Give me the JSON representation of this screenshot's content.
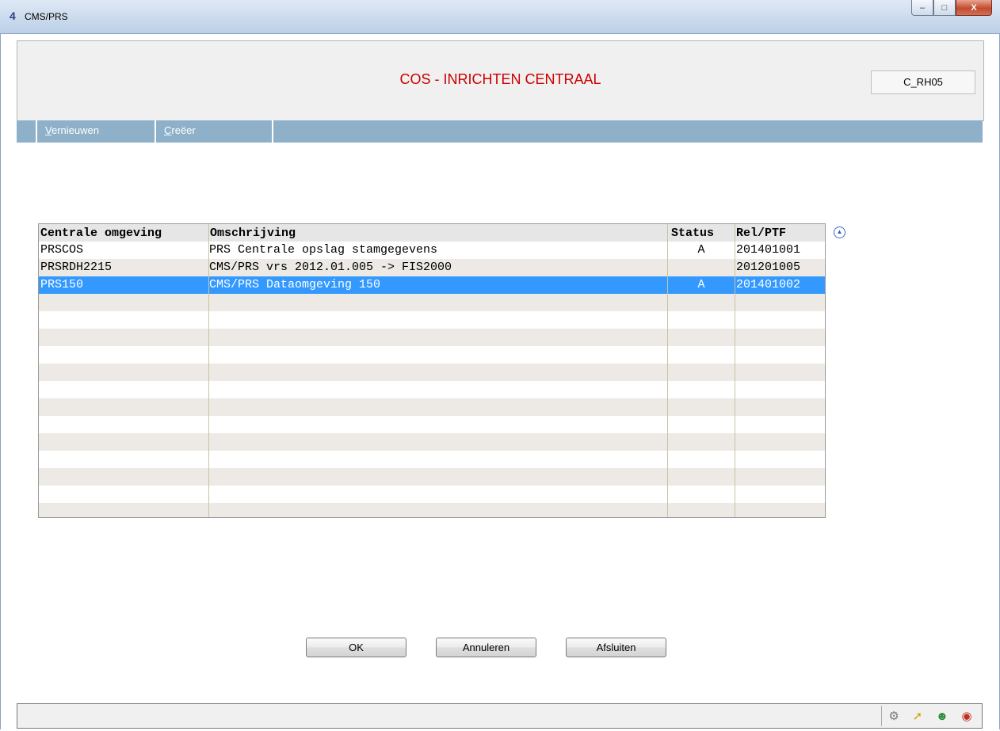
{
  "window": {
    "title": "CMS/PRS",
    "app_icon": "4",
    "minimize": "–",
    "maximize": "□",
    "close": "X"
  },
  "header": {
    "title": "COS - INRICHTEN CENTRAAL",
    "code": "C_RH05"
  },
  "menu": [
    {
      "label": "Vernieuwen",
      "accel": "V"
    },
    {
      "label": "Creëer",
      "accel": "C"
    }
  ],
  "table": {
    "columns": [
      "Centrale omgeving",
      "Omschrijving",
      "Status",
      "Rel/PTF"
    ],
    "rows": [
      {
        "omgeving": "PRSCOS",
        "omschrijving": "PRS Centrale opslag stamgegevens",
        "status": "A",
        "relptf": "201401001"
      },
      {
        "omgeving": "PRSRDH2215",
        "omschrijving": "CMS/PRS vrs 2012.01.005 -> FIS2000",
        "status": "",
        "relptf": "201201005"
      },
      {
        "omgeving": "PRS150",
        "omschrijving": "CMS/PRS Dataomgeving 150",
        "status": "A",
        "relptf": "201401002"
      }
    ],
    "selected_row": 2
  },
  "buttons": {
    "ok": "OK",
    "annuleren": "Annuleren",
    "afsluiten": "Afsluiten"
  },
  "icons": [
    "sort-toggle-icon",
    "connection-icon",
    "help-arrow-icon",
    "user-icon",
    "database-icon"
  ]
}
